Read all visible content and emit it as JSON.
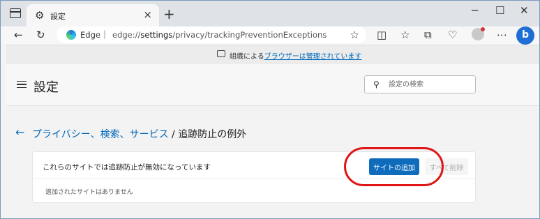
{
  "browser": {
    "tab_title": "設定",
    "address": {
      "brand": "Edge",
      "separator": "|",
      "url_prefix": "edge://",
      "url_bold": "settings",
      "url_rest": "/privacy/trackingPreventionExceptions"
    },
    "managed_prefix": "組織による",
    "managed_link": "ブラウザーは管理されています"
  },
  "settings": {
    "title": "設定",
    "search_placeholder": "設定の検索"
  },
  "breadcrumb": {
    "parent": "プライバシー、検索、サービス",
    "separator": " / ",
    "current": "追跡防止の例外"
  },
  "card": {
    "label": "これらのサイトでは追跡防止が無効になっています",
    "add_button": "サイトの追加",
    "remove_all_button": "すべて削除",
    "empty_text": "追加されたサイトはありません"
  },
  "colors": {
    "accent": "#0f6cbd",
    "link": "#0067b8",
    "annotation": "#e01515"
  }
}
